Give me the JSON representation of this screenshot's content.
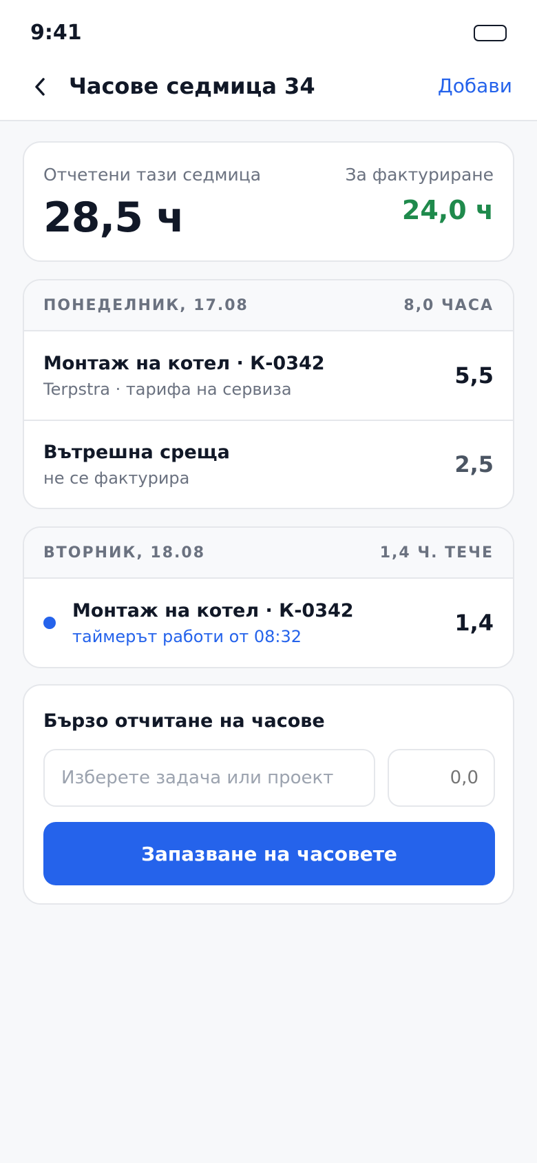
{
  "status_bar": {
    "time": "9:41"
  },
  "nav": {
    "back_icon": "chevron-left-icon",
    "title": "Часове седмица 34",
    "action_label": "Добави"
  },
  "summary": {
    "logged_label": "Отчетени тази седмица",
    "logged_value": "28,5 ч",
    "billable_label": "За фактуриране",
    "billable_value": "24,0 ч"
  },
  "days": [
    {
      "title": "ПОНЕДЕЛНИК, 17.08",
      "total": "8,0 ЧАСА",
      "entries": [
        {
          "title": "Монтаж на котел · К-0342",
          "subtitle": "Terpstra · тарифа на сервиза",
          "hours": "5,5"
        },
        {
          "title": "Вътрешна среща",
          "subtitle": "не се фактурира",
          "hours": "2,5"
        }
      ]
    },
    {
      "title": "ВТОРНИК, 18.08",
      "total": "1,4 Ч. ТЕЧЕ",
      "entries": [
        {
          "title": "Монтаж на котел · К-0342",
          "subtitle": "таймерът работи от 08:32",
          "hours": "1,4",
          "running": true
        }
      ]
    }
  ],
  "quick_entry": {
    "title": "Бързо отчитане на часове",
    "task_placeholder": "Изберете задача или проект",
    "hours_placeholder": "0,0",
    "save_label": "Запазване на часовете"
  },
  "colors": {
    "accent": "#2563eb",
    "billable": "#1f8a4c",
    "muted": "#6b7280",
    "background": "#f7f8fa"
  }
}
